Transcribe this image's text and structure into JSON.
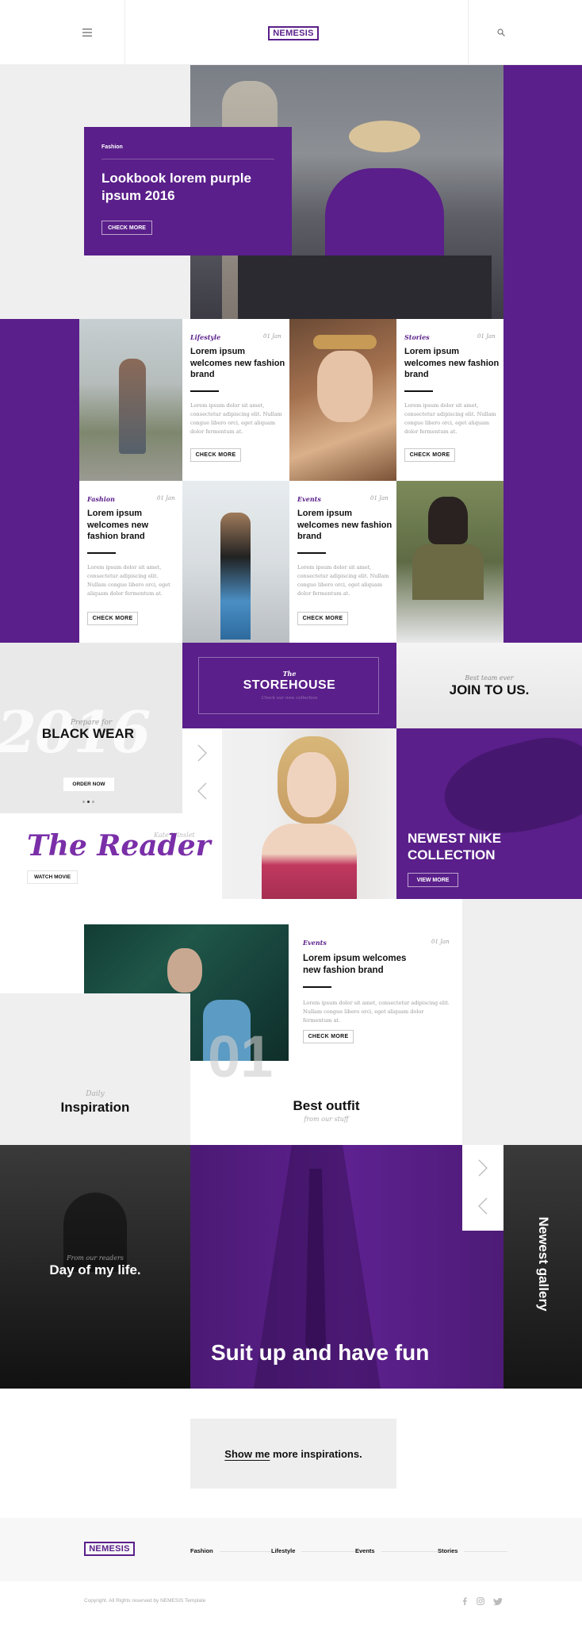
{
  "header": {
    "logo": "NEMESIS",
    "menu_icon": "hamburger-icon",
    "search_icon": "search-icon"
  },
  "hero": {
    "tag": "Fashion",
    "title": "Lookbook lorem purple ipsum 2016",
    "button": "CHECK MORE"
  },
  "cards": [
    {
      "tag": "Lifestyle",
      "date": "01 Jan",
      "title": "Lorem ipsum welcomes new fashion brand",
      "text": "Lorem ipsum dolor sit amet, consectetur adipiscing elit. Nullam congue libero orci, eget aliquam dolor fermentum at.",
      "button": "CHECK MORE"
    },
    {
      "tag": "Stories",
      "date": "01 Jan",
      "title": "Lorem ipsum welcomes new fashion brand",
      "text": "Lorem ipsum dolor sit amet, consectetur adipiscing elit. Nullam congue libero orci, eget aliquam dolor fermentum at.",
      "button": "CHECK MORE"
    },
    {
      "tag": "Fashion",
      "date": "01 Jan",
      "title": "Lorem ipsum welcomes new fashion brand",
      "text": "Lorem ipsum dolor sit amet, consectetur adipiscing elit. Nullam congue libero orci, eget aliquam dolor fermentum at.",
      "button": "CHECK MORE"
    },
    {
      "tag": "Events",
      "date": "01 Jan",
      "title": "Lorem ipsum welcomes new fashion brand",
      "text": "Lorem ipsum dolor sit amet, consectetur adipiscing elit. Nullam congue libero orci, eget aliquam dolor fermentum at.",
      "button": "CHECK MORE"
    }
  ],
  "blackwear": {
    "pre": "Prepare for",
    "title": "BLACK WEAR",
    "year": "2016",
    "button": "ORDER NOW"
  },
  "storehouse": {
    "pre": "The",
    "title": "STOREHOUSE",
    "sub": "Check our new collection"
  },
  "join": {
    "pre": "Best team ever",
    "title": "JOIN TO US."
  },
  "reader": {
    "title": "The Reader",
    "credit": "Kate Winslet",
    "button": "WATCH MOVIE"
  },
  "nike": {
    "title": "NEWEST NIKE COLLECTION",
    "button": "VIEW MORE"
  },
  "feature": {
    "tag": "Events",
    "date": "01 Jan",
    "title": "Lorem ipsum welcomes new fashion brand",
    "text": "Lorem ipsum dolor sit amet, consectetur adipiscing elit. Nullam congue libero orci, eget aliquam dolor fermentum at.",
    "button": "CHECK MORE",
    "number": "01"
  },
  "inspiration": {
    "pre": "Daily",
    "title": "Inspiration"
  },
  "outfit": {
    "title": "Best outfit",
    "sub": "from our stuff"
  },
  "dayoflife": {
    "pre": "From our readers",
    "title": "Day of my life."
  },
  "suitup": {
    "title": "Suit up and have fun"
  },
  "gallery": {
    "title": "Newest gallery"
  },
  "more": {
    "underlined": "Show me",
    "rest": " more inspirations."
  },
  "footer": {
    "logo": "NEMESIS",
    "links": [
      "Fashion",
      "Lifestyle",
      "Events",
      "Stories"
    ],
    "copyright": "Copyright. All Rights reserved by NEMESIS Template",
    "social": [
      "facebook-icon",
      "instagram-icon",
      "twitter-icon"
    ]
  },
  "colors": {
    "accent": "#5a1f8a",
    "light": "#efefef",
    "dark": "#1a1a1a"
  }
}
